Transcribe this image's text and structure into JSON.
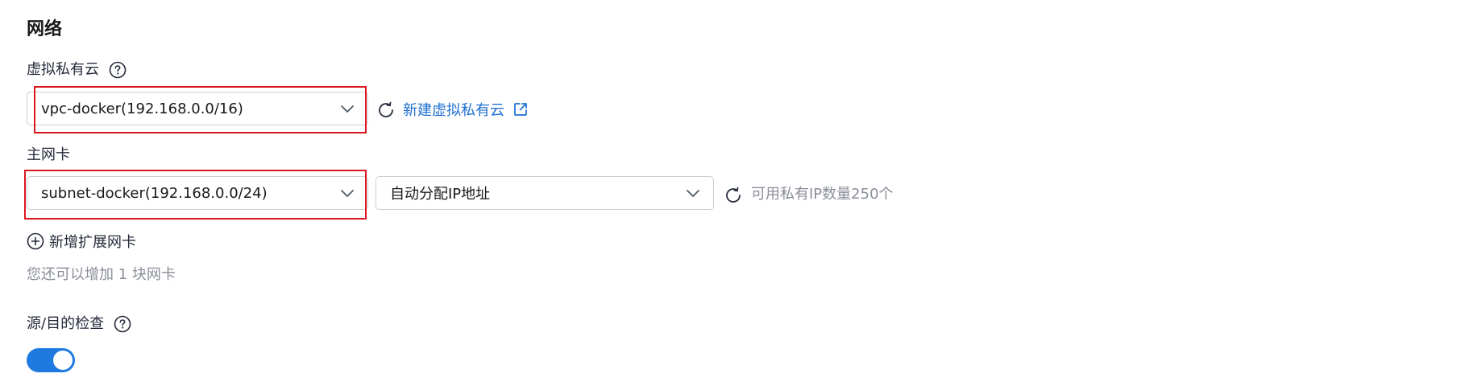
{
  "section": {
    "title": "网络"
  },
  "vpc": {
    "label": "虚拟私有云",
    "selected": "vpc-docker(192.168.0.0/16)",
    "create_link": "新建虚拟私有云"
  },
  "primary_nic": {
    "label": "主网卡",
    "subnet_selected": "subnet-docker(192.168.0.0/24)",
    "ip_mode_selected": "自动分配IP地址",
    "available_ip_text": "可用私有IP数量250个"
  },
  "extension_nic": {
    "add_label": "新增扩展网卡",
    "remaining_hint": "您还可以增加 1 块网卡"
  },
  "source_dest_check": {
    "label": "源/目的检查",
    "enabled": true
  },
  "colors": {
    "accent": "#1f7ae0",
    "link": "#1f6fd1",
    "highlight": "#d9161d"
  }
}
